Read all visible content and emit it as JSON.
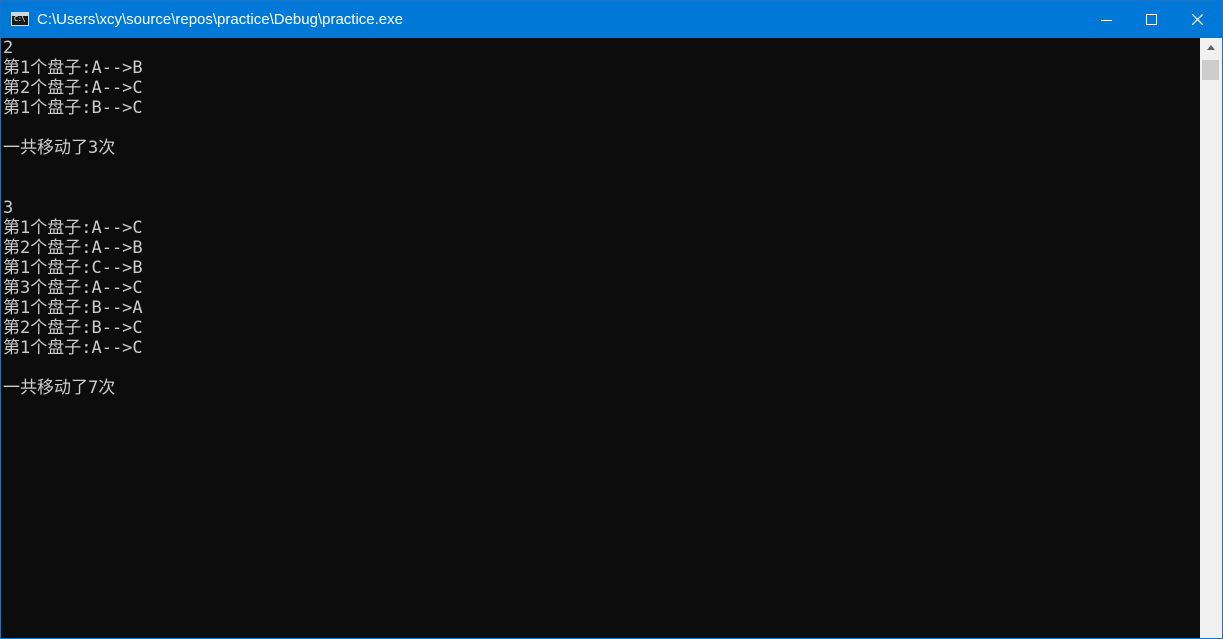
{
  "window": {
    "title": "C:\\Users\\xcy\\source\\repos\\practice\\Debug\\practice.exe",
    "icon_name": "console-app-icon",
    "icon_text": "C:\\",
    "accent_color": "#0078d7"
  },
  "console": {
    "lines": [
      "2",
      "第1个盘子:A-->B",
      "第2个盘子:A-->C",
      "第1个盘子:B-->C",
      "",
      "一共移动了3次",
      "",
      "",
      "3",
      "第1个盘子:A-->C",
      "第2个盘子:A-->B",
      "第1个盘子:C-->B",
      "第3个盘子:A-->C",
      "第1个盘子:B-->A",
      "第2个盘子:B-->C",
      "第1个盘子:A-->C",
      "",
      "一共移动了7次"
    ],
    "background_color": "#0c0c0c",
    "text_color": "#cccccc"
  }
}
